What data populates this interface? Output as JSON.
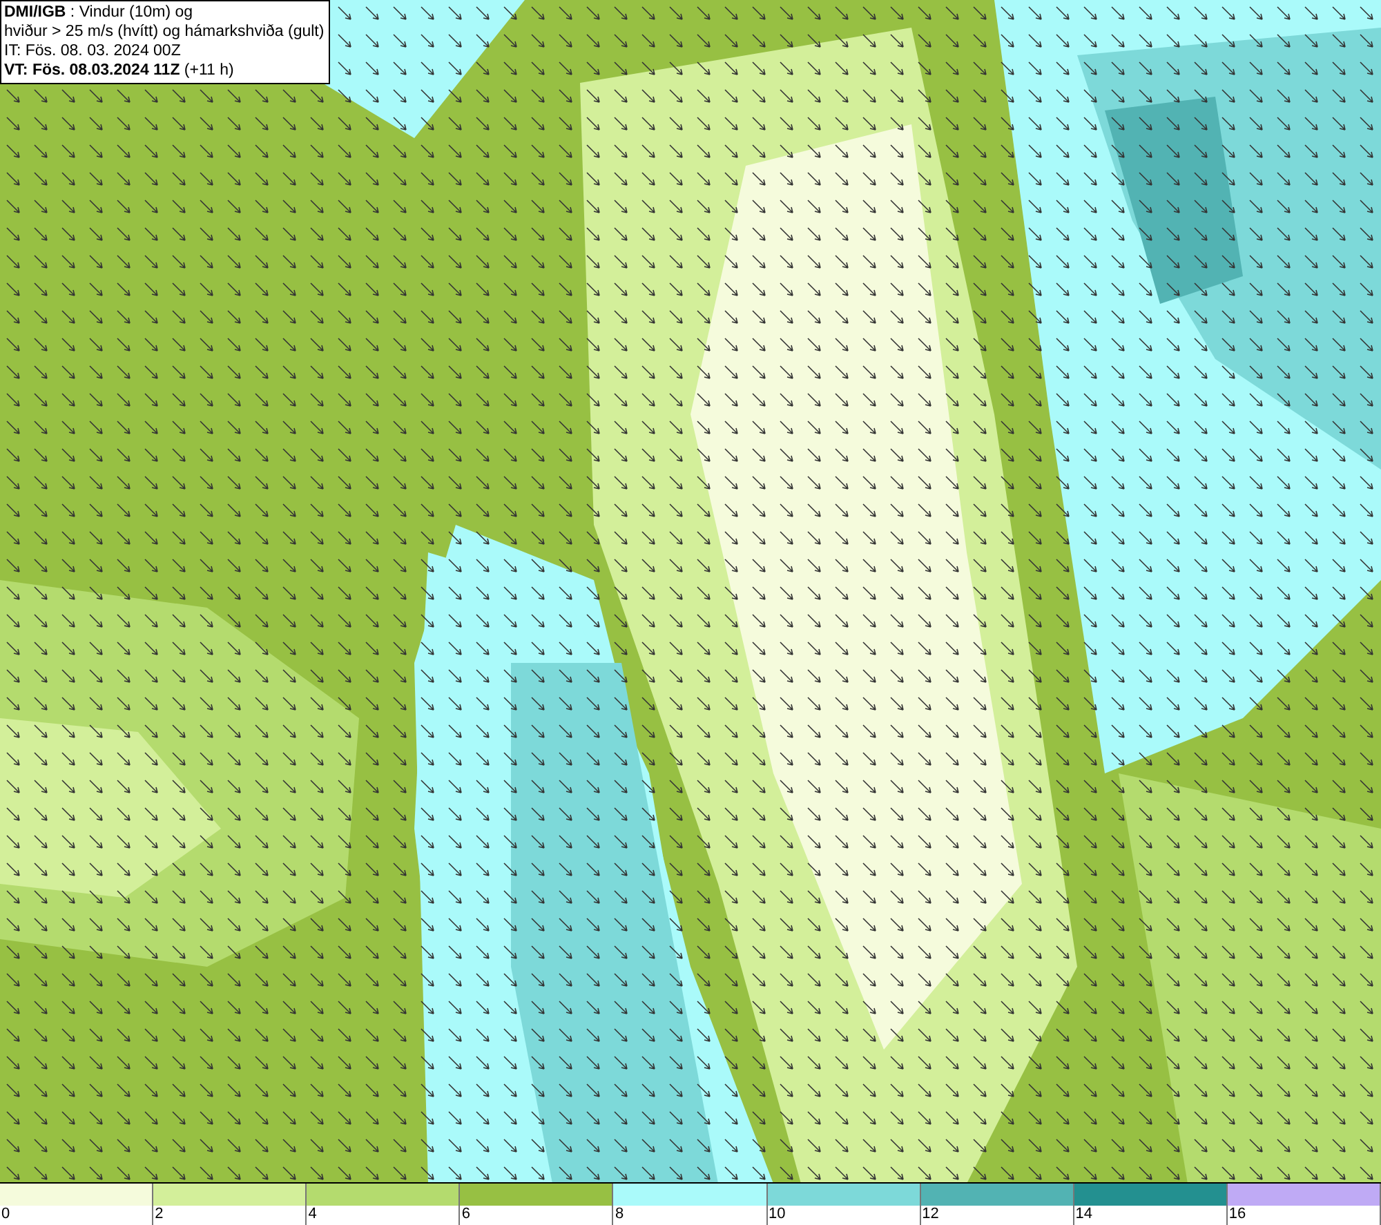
{
  "header": {
    "lines": [
      "**DMI/IGB** : Vindur (10m) og",
      "hviður > 25 m/s (hvítt) og hámarkshviða (gult)",
      "IT: Fös. 08. 03. 2024 00Z",
      "**VT: Fös. 08.03.2024 11Z** (+11 h)"
    ]
  },
  "legend": [
    {
      "label": "0",
      "color": "#f5fbdc"
    },
    {
      "label": "2",
      "color": "#d3ef9a"
    },
    {
      "label": "4",
      "color": "#b4db6e"
    },
    {
      "label": "6",
      "color": "#97c043"
    },
    {
      "label": "8",
      "color": "#aafafa"
    },
    {
      "label": "10",
      "color": "#7dd9d9"
    },
    {
      "label": "12",
      "color": "#52b3b3"
    },
    {
      "label": "14",
      "color": "#239090"
    },
    {
      "label": "16",
      "color": "#bfaaf5"
    }
  ]
}
